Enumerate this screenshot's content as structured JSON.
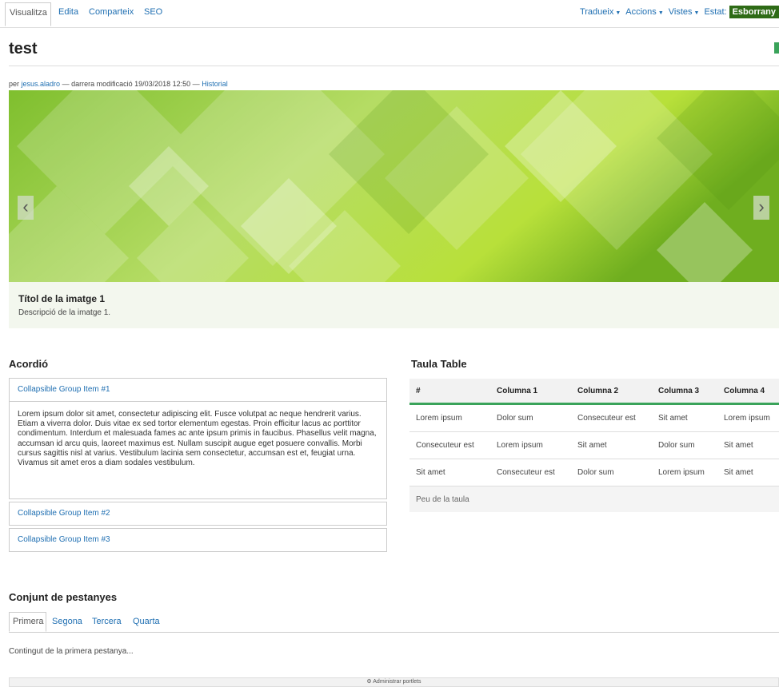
{
  "toolbar": {
    "tabs": [
      "Visualitza",
      "Edita",
      "Comparteix",
      "SEO"
    ],
    "menus": [
      "Tradueix",
      "Accions",
      "Vistes"
    ],
    "estat_label": "Estat:",
    "estat_value": "Esborrany"
  },
  "page": {
    "title": "test",
    "byline_prefix": "per",
    "author": "jesus.aladro",
    "byline_middle": "— darrera modificació 19/03/2018 12:50 —",
    "history": "Historial"
  },
  "carousel": {
    "prev_icon": "‹",
    "next_icon": "›",
    "caption_title": "Títol de la imatge 1",
    "caption_desc": "Descripció de la imatge 1."
  },
  "accordion": {
    "heading": "Acordió",
    "items": [
      {
        "title": "Collapsible Group Item #1",
        "body": "Lorem ipsum dolor sit amet, consectetur adipiscing elit. Fusce volutpat ac neque hendrerit varius. Etiam a viverra dolor. Duis vitae ex sed tortor elementum egestas. Proin efficitur lacus ac porttitor condimentum. Interdum et malesuada fames ac ante ipsum primis in faucibus. Phasellus velit magna, accumsan id arcu quis, laoreet maximus est. Nullam suscipit augue eget posuere convallis. Morbi cursus sagittis nisl at varius. Vestibulum lacinia sem consectetur, accumsan est et, feugiat urna. Vivamus sit amet eros a diam sodales vestibulum."
      },
      {
        "title": "Collapsible Group Item #2"
      },
      {
        "title": "Collapsible Group Item #3"
      }
    ]
  },
  "table": {
    "heading": "Taula Table",
    "columns": [
      "#",
      "Columna 1",
      "Columna 2",
      "Columna 3",
      "Columna 4"
    ],
    "rows": [
      [
        "Lorem ipsum",
        "Dolor sum",
        "Consecuteur est",
        "Sit amet",
        "Lorem ipsum"
      ],
      [
        "Consecuteur est",
        "Lorem ipsum",
        "Sit amet",
        "Dolor sum",
        "Sit amet"
      ],
      [
        "Sit amet",
        "Consecuteur est",
        "Dolor sum",
        "Lorem ipsum",
        "Sit amet"
      ]
    ],
    "footer": "Peu de la taula"
  },
  "tabs_section": {
    "heading": "Conjunt de pestanyes",
    "tabs": [
      "Primera",
      "Segona",
      "Tercera",
      "Quarta"
    ],
    "content": "Contingut de la primera pestanya..."
  },
  "admin": {
    "icon": "gear-icon",
    "label": "Administrar portlets"
  },
  "colors": {
    "link": "#1f6fb2",
    "estat_bg": "#2e6b16",
    "accent_green": "#3aa35a"
  }
}
